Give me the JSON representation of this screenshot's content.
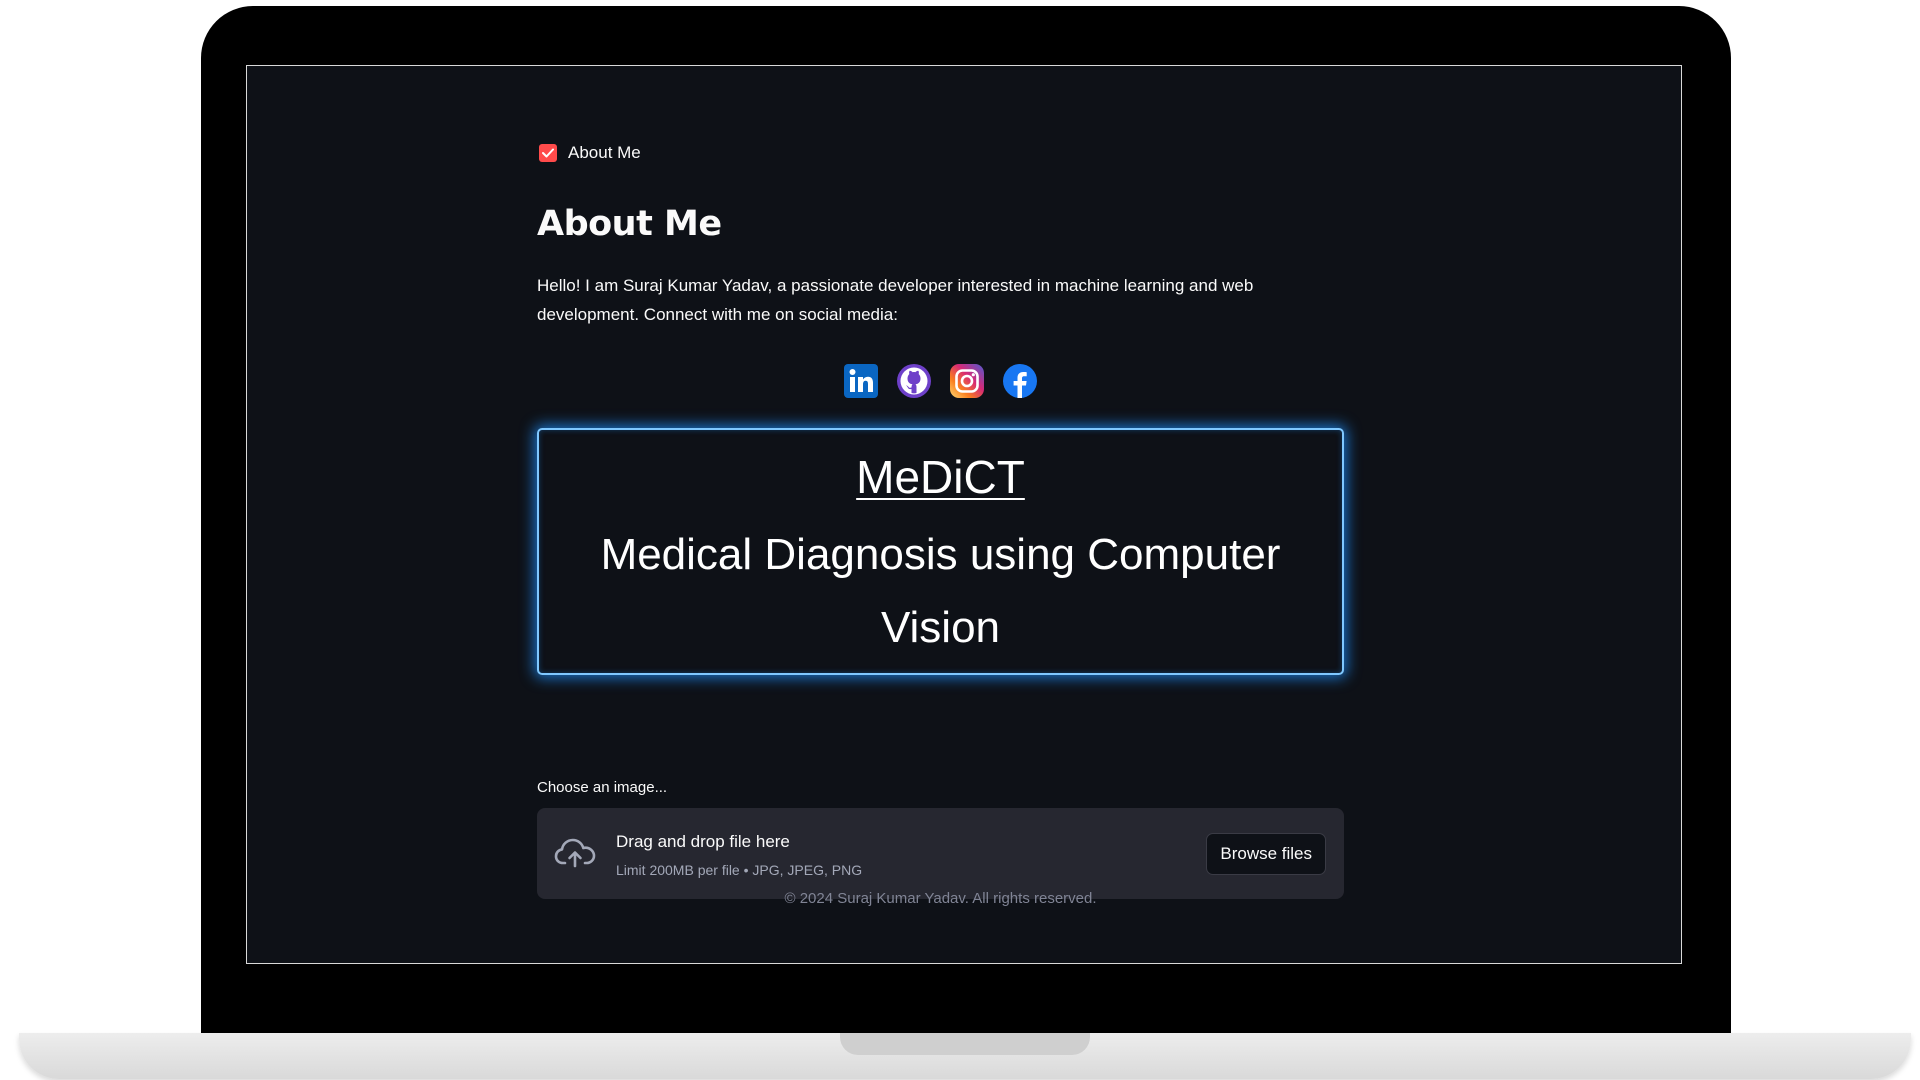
{
  "checkbox": {
    "label": "About Me",
    "checked": true,
    "color": "#ff4b4b"
  },
  "about": {
    "title": "About Me",
    "intro": "Hello! I am Suraj Kumar Yadav, a passionate developer interested in machine learning and web development. Connect with me on social media:"
  },
  "social": [
    {
      "icon": "linkedin-icon",
      "color": "#0a66c2"
    },
    {
      "icon": "github-icon",
      "color": "#6e40c9"
    },
    {
      "icon": "instagram-icon",
      "color": "#e1306c"
    },
    {
      "icon": "facebook-icon",
      "color": "#1877f2"
    }
  ],
  "hero": {
    "title": "MeDiCT",
    "subtitle": "Medical Diagnosis using Computer Vision",
    "glow_color": "#1e90ff"
  },
  "uploader": {
    "label": "Choose an image...",
    "drop_title": "Drag and drop file here",
    "limit": "Limit 200MB per file • JPG, JPEG, PNG",
    "browse_label": "Browse files",
    "icon": "upload-cloud-icon"
  },
  "footer": {
    "text": "© 2024 Suraj Kumar Yadav. All rights reserved."
  },
  "theme": {
    "background": "#0e1117",
    "dropzone": "#262730",
    "text": "#fafafa"
  }
}
